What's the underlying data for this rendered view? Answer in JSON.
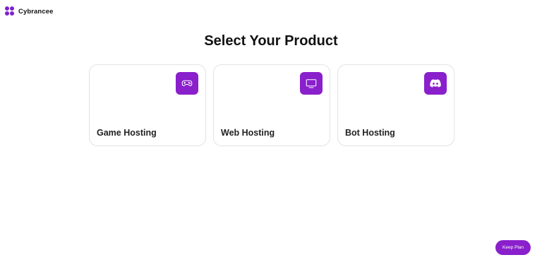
{
  "header": {
    "brand": "Cybrancee"
  },
  "page": {
    "title": "Select Your Product"
  },
  "products": [
    {
      "label": "Game Hosting",
      "icon": "gamepad-icon"
    },
    {
      "label": "Web Hosting",
      "icon": "monitor-icon"
    },
    {
      "label": "Bot Hosting",
      "icon": "discord-icon"
    }
  ],
  "actions": {
    "keep_plan": "Keep Plan"
  },
  "colors": {
    "accent": "#8a1fcc",
    "logo": "#7e22ce",
    "card_border": "#e3e3e6"
  }
}
